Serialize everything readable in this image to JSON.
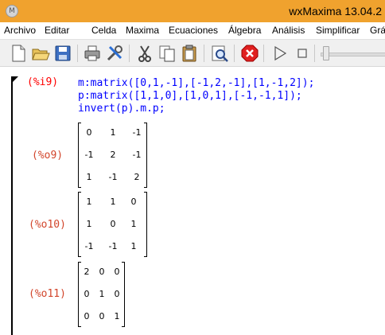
{
  "window": {
    "title": "wxMaxima 13.04.2",
    "icon": "maxima-app-icon",
    "icon_glyph": "M"
  },
  "menu": {
    "items": [
      "Archivo",
      "Editar",
      "Celda",
      "Maxima",
      "Ecuaciones",
      "Álgebra",
      "Análisis",
      "Simplificar",
      "Grá"
    ]
  },
  "toolbar": {
    "buttons": [
      "new-document-icon",
      "open-folder-icon",
      "save-icon",
      "print-icon",
      "preferences-icon",
      "cut-icon",
      "copy-icon",
      "paste-icon",
      "find-icon",
      "interrupt-icon",
      "play-icon",
      "stop-icon"
    ],
    "slider_level": 0
  },
  "cell": {
    "input_label": "(%i9)",
    "code_lines": [
      "m:matrix([0,1,-1],[-1,2,-1],[1,-1,2]);",
      "p:matrix([1,1,0],[1,0,1],[-1,-1,1]);",
      "invert(p).m.p;"
    ],
    "outputs": [
      {
        "label": "(%o9)",
        "rows": [
          [
            "0",
            "1",
            "-1"
          ],
          [
            "-1",
            "2",
            "-1"
          ],
          [
            "1",
            "-1",
            "2"
          ]
        ]
      },
      {
        "label": "(%o10)",
        "rows": [
          [
            "1",
            "1",
            "0"
          ],
          [
            "1",
            "0",
            "1"
          ],
          [
            "-1",
            "-1",
            "1"
          ]
        ]
      },
      {
        "label": "(%o11)",
        "rows": [
          [
            "2",
            "0",
            "0"
          ],
          [
            "0",
            "1",
            "0"
          ],
          [
            "0",
            "0",
            "1"
          ]
        ]
      }
    ]
  },
  "colors": {
    "titlebar": "#f0a22e",
    "input_label": "#ff0000",
    "output_label": "#d2452b",
    "code": "#0000ff"
  }
}
